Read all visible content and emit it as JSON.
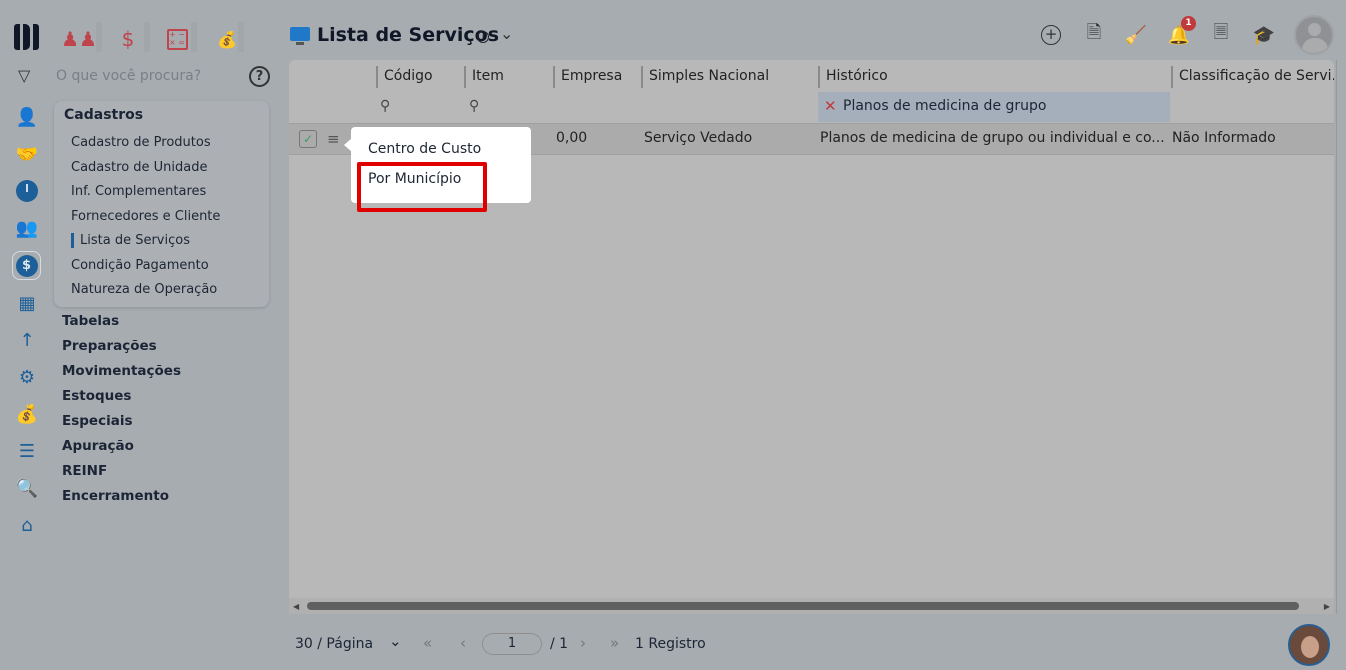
{
  "header": {
    "title": "Lista de Serviços",
    "search_placeholder": "O que você procura?",
    "notification_count": "1"
  },
  "sidebar": {
    "section_title": "Cadastros",
    "sub_items": [
      "Cadastro de Produtos",
      "Cadastro de Unidade",
      "Inf. Complementares",
      "Fornecedores e Cliente",
      "Lista de Serviços",
      "Condição Pagamento",
      "Natureza de Operação"
    ],
    "active_index": 4,
    "categories": [
      "Tabelas",
      "Preparações",
      "Movimentações",
      "Estoques",
      "Especiais",
      "Apuração",
      "REINF",
      "Encerramento"
    ]
  },
  "grid": {
    "columns": [
      "Código",
      "Item",
      "Empresa",
      "Simples Nacional",
      "Histórico",
      "Classificação de Servi."
    ],
    "filter_value": "Planos de medicina de grupo",
    "row": {
      "empresa": "0,00",
      "simples": "Serviço Vedado",
      "historico": "Planos de medicina de grupo ou individual e co...",
      "classificacao": "Não Informado"
    }
  },
  "popup": {
    "items": [
      "Centro de Custo",
      "Por Município"
    ]
  },
  "pagination": {
    "page_size": "30 / Página",
    "current_page": "1",
    "total_pages": "/ 1",
    "records": "1 Registro"
  },
  "colors": {
    "accent": "#1d5f98",
    "highlight": "#e00000",
    "badge": "#c0393b"
  }
}
